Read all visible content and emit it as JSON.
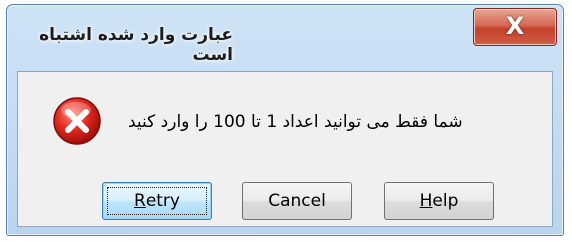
{
  "window": {
    "title": "عبارت وارد شده اشتباه است",
    "close_glyph": "X"
  },
  "dialog": {
    "icon": "error-icon",
    "message": "شما فقط می توانید اعداد 1 تا 100 را وارد کنید"
  },
  "buttons": {
    "retry": {
      "mnemonic": "R",
      "rest": "etry"
    },
    "cancel": {
      "label": "Cancel"
    },
    "help": {
      "mnemonic": "H",
      "rest": "elp"
    }
  },
  "colors": {
    "error_red": "#d9251d",
    "close_red": "#c2402a",
    "title_frame": "#b9d4ee"
  }
}
